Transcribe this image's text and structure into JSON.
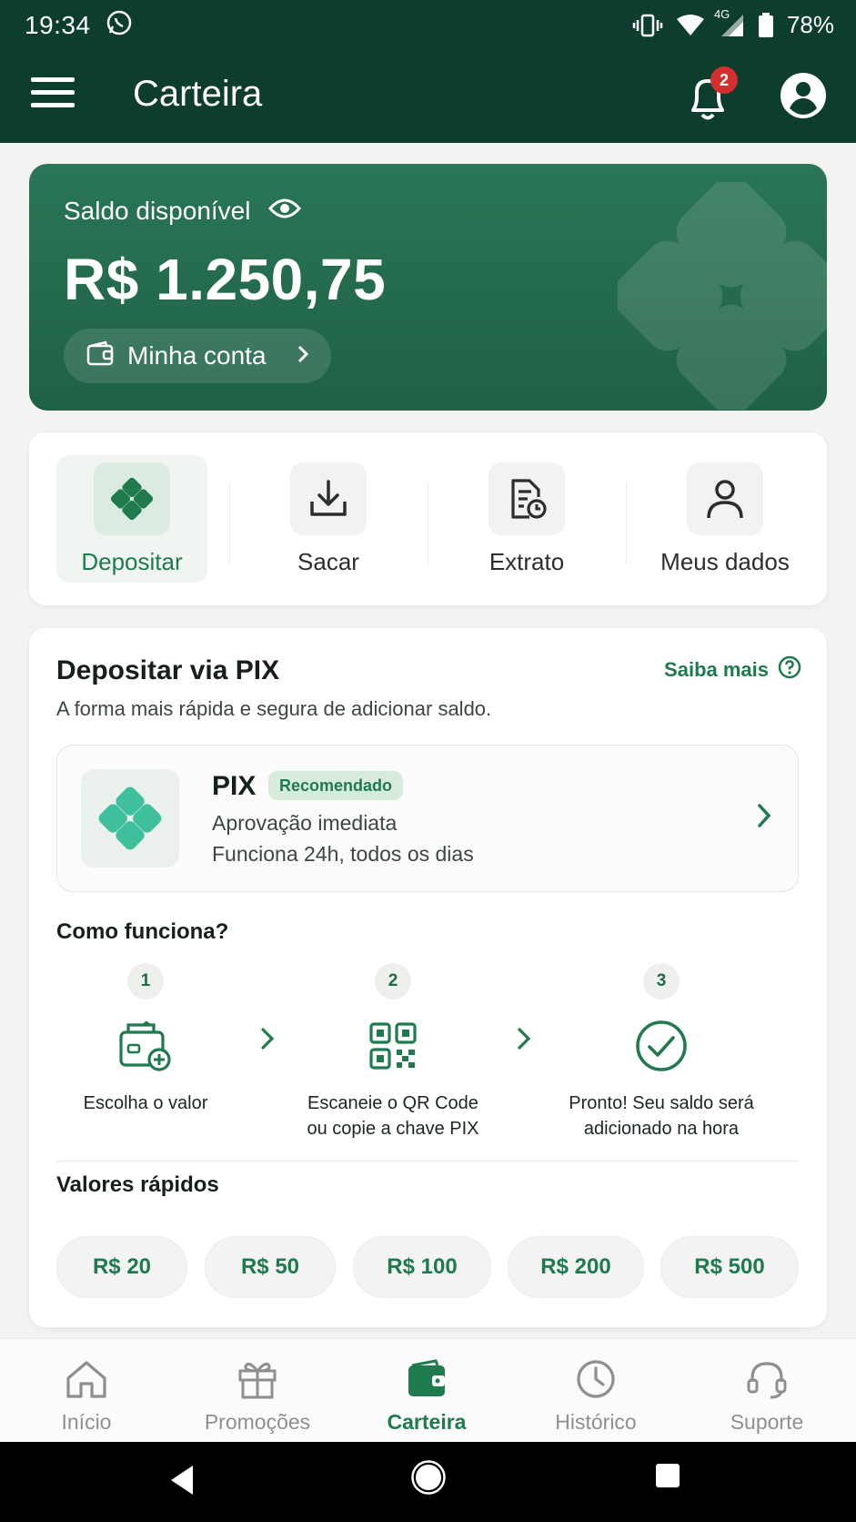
{
  "status_bar": {
    "time": "19:34",
    "network": "4G",
    "battery": "78%"
  },
  "app_bar": {
    "title": "Carteira",
    "notification_count": "2"
  },
  "balance": {
    "label": "Saldo disponível",
    "value": "R$ 1.250,75",
    "account_link": "Minha conta"
  },
  "actions": [
    {
      "label": "Depositar",
      "icon": "pix-icon",
      "active": true
    },
    {
      "label": "Sacar",
      "icon": "download-icon"
    },
    {
      "label": "Extrato",
      "icon": "statement-icon"
    },
    {
      "label": "Meus dados",
      "icon": "person-icon"
    }
  ],
  "pix": {
    "title": "Depositar via PIX",
    "subtitle": "A forma mais rápida e segura de adicionar saldo.",
    "learn_more": "Saiba mais",
    "option_name": "PIX",
    "badge": "Recomendado",
    "line1": "Aprovação imediata",
    "line2": "Funciona 24h, todos os dias",
    "how_title": "Como funciona?",
    "steps": [
      {
        "num": "1",
        "text_line1": "Escolha o valor",
        "text_line2": ""
      },
      {
        "num": "2",
        "text_line1": "Escaneie o QR Code",
        "text_line2": "ou copie a chave PIX"
      },
      {
        "num": "3",
        "text_line1": "Pronto! Seu saldo será",
        "text_line2": "adicionado na hora"
      }
    ],
    "quick_title": "Valores rápidos",
    "quick_values": [
      "R$ 20",
      "R$ 50",
      "R$ 100",
      "R$ 200",
      "R$ 500"
    ]
  },
  "bottom_nav": [
    {
      "label": "Início",
      "icon": "home-icon"
    },
    {
      "label": "Promoções",
      "icon": "gift-icon"
    },
    {
      "label": "Carteira",
      "icon": "wallet-icon",
      "active": true
    },
    {
      "label": "Histórico",
      "icon": "clock-icon"
    },
    {
      "label": "Suporte",
      "icon": "headset-icon"
    }
  ],
  "colors": {
    "header": "#0d3d2c",
    "card": "#22694b",
    "accent": "#1f7a4d",
    "badge": "#d32f2f"
  }
}
